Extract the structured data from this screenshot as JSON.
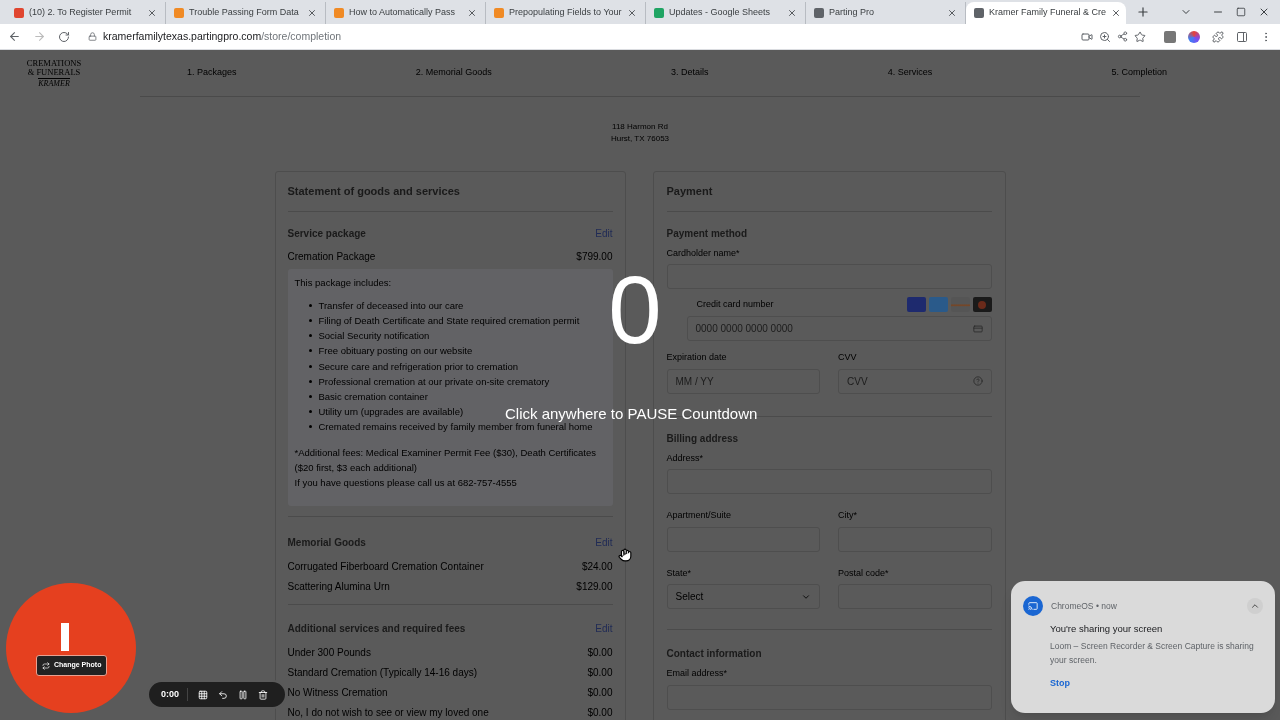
{
  "browser": {
    "tabs": [
      {
        "label": "(10) 2. To Register Permit",
        "color": "#e0452f",
        "selected": false
      },
      {
        "label": "Trouble Passing Form Data",
        "color": "#f08a24",
        "selected": false
      },
      {
        "label": "How to Automatically Pass",
        "color": "#f08a24",
        "selected": false
      },
      {
        "label": "Prepopulating Fields to Your",
        "color": "#f08a24",
        "selected": false
      },
      {
        "label": "Updates - Google Sheets",
        "color": "#1fa463",
        "selected": false
      },
      {
        "label": "Parting Pro",
        "color": "#5f6368",
        "selected": false
      },
      {
        "label": "Kramer Family Funeral & Cre",
        "color": "#5f6368",
        "selected": true
      }
    ],
    "url_host": "kramerfamilytexas.partingpro.com",
    "url_path": "/store/completion"
  },
  "site": {
    "logo": [
      "CREMATIONS",
      "& FUNERALS",
      "KRAMER"
    ],
    "steps": [
      "1. Packages",
      "2. Memorial Goods",
      "3. Details",
      "4. Services",
      "5. Completion"
    ],
    "address": [
      "118 Harmon Rd",
      "Hurst, TX 76053"
    ]
  },
  "statement": {
    "title": "Statement of goods and services",
    "sections": [
      {
        "title": "Service package",
        "edit": "Edit",
        "items": [
          {
            "name": "Cremation Package",
            "price": "$799.00"
          }
        ],
        "package": {
          "intro": "This package includes:",
          "bullets": [
            "Transfer of deceased into our care",
            "Filing of Death Certificate and State required cremation permit",
            "Social Security notification",
            "Free obituary posting on our website",
            "Secure care and refrigeration prior to cremation",
            "Professional cremation at our private on-site crematory",
            "Basic cremation container",
            "Utility urn (upgrades are available)",
            "Cremated remains received by family member from funeral home"
          ],
          "notes": [
            "*Additional fees: Medical Examiner Permit Fee ($30), Death Certificates ($20 first, $3 each additional)",
            "If you have questions please call us at 682-757-4555"
          ]
        }
      },
      {
        "title": "Memorial Goods",
        "edit": "Edit",
        "items": [
          {
            "name": "Corrugated Fiberboard Cremation Container",
            "price": "$24.00"
          },
          {
            "name": "Scattering Alumina Urn",
            "price": "$129.00"
          }
        ]
      },
      {
        "title": "Additional services and required fees",
        "edit": "Edit",
        "items": [
          {
            "name": "Under 300 Pounds",
            "price": "$0.00"
          },
          {
            "name": "Standard Cremation (Typically 14-16 days)",
            "price": "$0.00"
          },
          {
            "name": "No Witness Cremation",
            "price": "$0.00"
          },
          {
            "name": "No, I do not wish to see or view my loved one",
            "price": "$0.00"
          }
        ]
      }
    ]
  },
  "payment": {
    "title": "Payment",
    "method_title": "Payment method",
    "cardholder_label": "Cardholder name*",
    "card_label": "Credit card number",
    "card_placeholder": "0000  0000  0000  0000",
    "expiry_label": "Expiration date",
    "expiry_placeholder": "MM / YY",
    "cvv_label": "CVV",
    "cvv_placeholder": "CVV",
    "billing_title": "Billing address",
    "address_label": "Address*",
    "apt_label": "Apartment/Suite",
    "city_label": "City*",
    "state_label": "State*",
    "state_value": "Select",
    "postal_label": "Postal code*",
    "contact_title": "Contact information",
    "email_label": "Email address*"
  },
  "countdown": {
    "number": "0",
    "hint": "Click anywhere to PAUSE Countdown"
  },
  "recorder": {
    "change_photo": "Change Photo",
    "time": "0:00"
  },
  "notification": {
    "app": "ChromeOS",
    "separator": "•",
    "when": "now",
    "title": "You're sharing your screen",
    "body": "Loom – Screen Recorder & Screen Capture is sharing your screen.",
    "action": "Stop"
  }
}
